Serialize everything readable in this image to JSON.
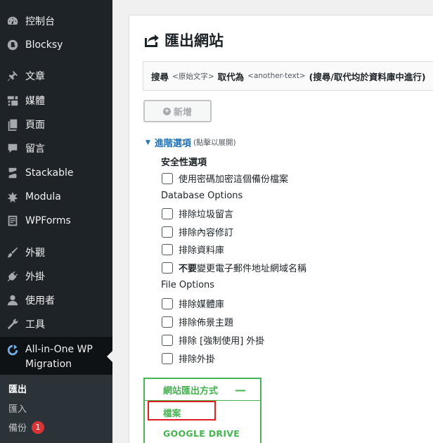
{
  "sidebar": {
    "items": [
      {
        "key": "dashboard",
        "label": "控制台",
        "icon": "dashboard-icon"
      },
      {
        "key": "blocksy",
        "label": "Blocksy",
        "icon": "blocksy-icon"
      },
      {
        "key": "posts",
        "label": "文章",
        "icon": "pin-icon"
      },
      {
        "key": "media",
        "label": "媒體",
        "icon": "media-icon"
      },
      {
        "key": "pages",
        "label": "頁面",
        "icon": "page-icon"
      },
      {
        "key": "comments",
        "label": "留言",
        "icon": "comment-icon"
      },
      {
        "key": "stackable",
        "label": "Stackable",
        "icon": "stackable-icon"
      },
      {
        "key": "modula",
        "label": "Modula",
        "icon": "modula-icon"
      },
      {
        "key": "wpforms",
        "label": "WPForms",
        "icon": "wpforms-icon"
      },
      {
        "key": "appearance",
        "label": "外觀",
        "icon": "brush-icon"
      },
      {
        "key": "plugins",
        "label": "外掛",
        "icon": "plug-icon"
      },
      {
        "key": "users",
        "label": "使用者",
        "icon": "user-icon"
      },
      {
        "key": "tools",
        "label": "工具",
        "icon": "wrench-icon"
      },
      {
        "key": "aio",
        "label": "All-in-One WP Migration",
        "icon": "aio-migration-icon"
      }
    ],
    "submenu": [
      {
        "label": "匯出",
        "active": true
      },
      {
        "label": "匯入",
        "active": false
      },
      {
        "label": "備份",
        "active": false,
        "badge": "1"
      }
    ]
  },
  "page": {
    "title": "匯出網站",
    "find_replace": {
      "search_label": "搜尋",
      "search_placeholder": "<原始文字>",
      "replace_label": "取代為",
      "replace_placeholder": "<another-text>",
      "note": "(搜尋/取代均於資料庫中進行)"
    },
    "add_button": "新增",
    "advanced": {
      "link": "進階選項",
      "hint": "(點擊以展開)"
    },
    "security_heading": "安全性選項",
    "security_options": [
      "使用密碼加密這個備份檔案"
    ],
    "database_heading": "Database Options",
    "database_options": [
      {
        "prefix": "",
        "label": "排除垃圾留言"
      },
      {
        "prefix": "",
        "label": "排除內容修訂"
      },
      {
        "prefix": "",
        "label": "排除資料庫"
      },
      {
        "prefix": "不要",
        "label": "變更電子郵件地址網域名稱"
      }
    ],
    "file_heading": "File Options",
    "file_options": [
      "排除媒體庫",
      "排除佈景主題",
      "排除 [強制使用] 外掛",
      "排除外掛"
    ],
    "export_to": {
      "label": "網站匯出方式",
      "collapse_symbol": "—",
      "options": [
        "檔案",
        "GOOGLE DRIVE"
      ]
    }
  },
  "colors": {
    "sidebar_bg": "#1d2327",
    "accent_blue": "#2271b1",
    "export_green": "#46b450",
    "highlight_red": "#e02020",
    "badge_red": "#d63638"
  }
}
